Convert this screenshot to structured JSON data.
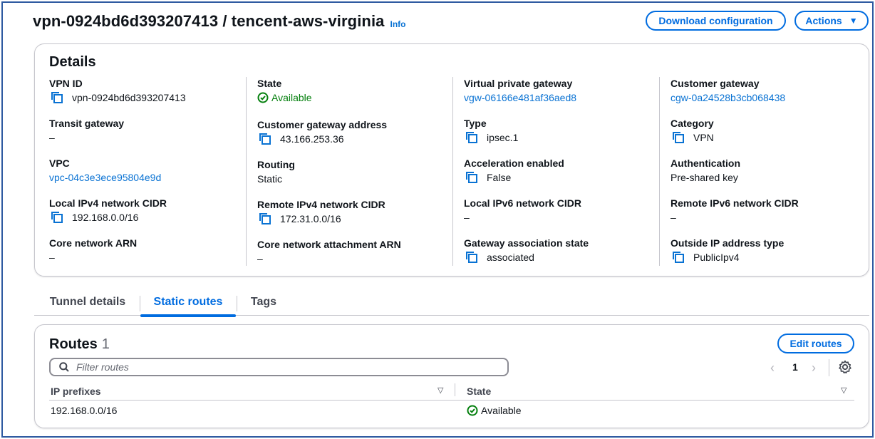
{
  "header": {
    "title": "vpn-0924bd6d393207413 / tencent-aws-virginia",
    "info": "Info",
    "download_button": "Download configuration",
    "actions_button": "Actions"
  },
  "details": {
    "title": "Details",
    "vpn_id": {
      "label": "VPN ID",
      "value": "vpn-0924bd6d393207413"
    },
    "transit_gateway": {
      "label": "Transit gateway",
      "value": "–"
    },
    "vpc": {
      "label": "VPC",
      "value": "vpc-04c3e3ece95804e9d"
    },
    "local_ipv4": {
      "label": "Local IPv4 network CIDR",
      "value": "192.168.0.0/16"
    },
    "core_network_arn": {
      "label": "Core network ARN",
      "value": "–"
    },
    "state": {
      "label": "State",
      "value": "Available"
    },
    "cgw_address": {
      "label": "Customer gateway address",
      "value": "43.166.253.36"
    },
    "routing": {
      "label": "Routing",
      "value": "Static"
    },
    "remote_ipv4": {
      "label": "Remote IPv4 network CIDR",
      "value": "172.31.0.0/16"
    },
    "core_attachment_arn": {
      "label": "Core network attachment ARN",
      "value": "–"
    },
    "vpg": {
      "label": "Virtual private gateway",
      "value": "vgw-06166e481af36aed8"
    },
    "type": {
      "label": "Type",
      "value": "ipsec.1"
    },
    "acceleration": {
      "label": "Acceleration enabled",
      "value": "False"
    },
    "local_ipv6": {
      "label": "Local IPv6 network CIDR",
      "value": "–"
    },
    "gw_assoc_state": {
      "label": "Gateway association state",
      "value": "associated"
    },
    "customer_gateway": {
      "label": "Customer gateway",
      "value": "cgw-0a24528b3cb068438"
    },
    "category": {
      "label": "Category",
      "value": "VPN"
    },
    "authentication": {
      "label": "Authentication",
      "value": "Pre-shared key"
    },
    "remote_ipv6": {
      "label": "Remote IPv6 network CIDR",
      "value": "–"
    },
    "outside_ip_type": {
      "label": "Outside IP address type",
      "value": "PublicIpv4"
    }
  },
  "tabs": [
    {
      "label": "Tunnel details",
      "active": false
    },
    {
      "label": "Static routes",
      "active": true
    },
    {
      "label": "Tags",
      "active": false
    }
  ],
  "routes": {
    "title": "Routes",
    "count": "1",
    "edit_button": "Edit routes",
    "search_placeholder": "Filter routes",
    "page": "1",
    "columns": [
      "IP prefixes",
      "State"
    ],
    "rows": [
      {
        "prefix": "192.168.0.0/16",
        "state": "Available"
      }
    ]
  },
  "colors": {
    "accent": "#006ce0",
    "link": "#0972d3",
    "success": "#037f0c",
    "border": "#c6c6cd"
  },
  "icons": [
    "copy-icon",
    "status-available-icon",
    "search-icon",
    "chevron-left-icon",
    "chevron-right-icon",
    "settings-gear-icon",
    "sort-caret-icon",
    "caret-down-icon"
  ]
}
